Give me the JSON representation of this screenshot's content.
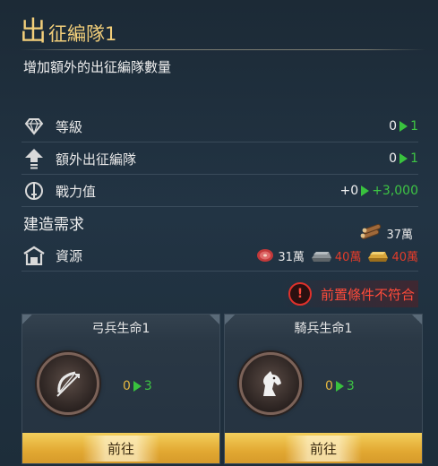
{
  "header": {
    "title_first": "出",
    "title_rest": "征編隊1"
  },
  "subtitle": "增加額外的出征編隊數量",
  "stats": [
    {
      "label": "等級",
      "current": "0",
      "next": "1"
    },
    {
      "label": "額外出征編隊",
      "current": "0",
      "next": "1"
    },
    {
      "label": "戰力值",
      "current": "+0",
      "next": "+3,000"
    }
  ],
  "requirements": {
    "title": "建造需求",
    "resource_label": "資源",
    "wood": "37萬",
    "meat": "31萬",
    "iron": "40萬",
    "gold": "40萬"
  },
  "warning": "前置條件不符合",
  "cards": [
    {
      "title": "弓兵生命1",
      "current": "0",
      "next": "3",
      "button": "前往"
    },
    {
      "title": "騎兵生命1",
      "current": "0",
      "next": "3",
      "button": "前往"
    }
  ],
  "colors": {
    "accent_gold": "#f3cf7a",
    "green": "#3ec544",
    "red": "#e23c2a"
  }
}
